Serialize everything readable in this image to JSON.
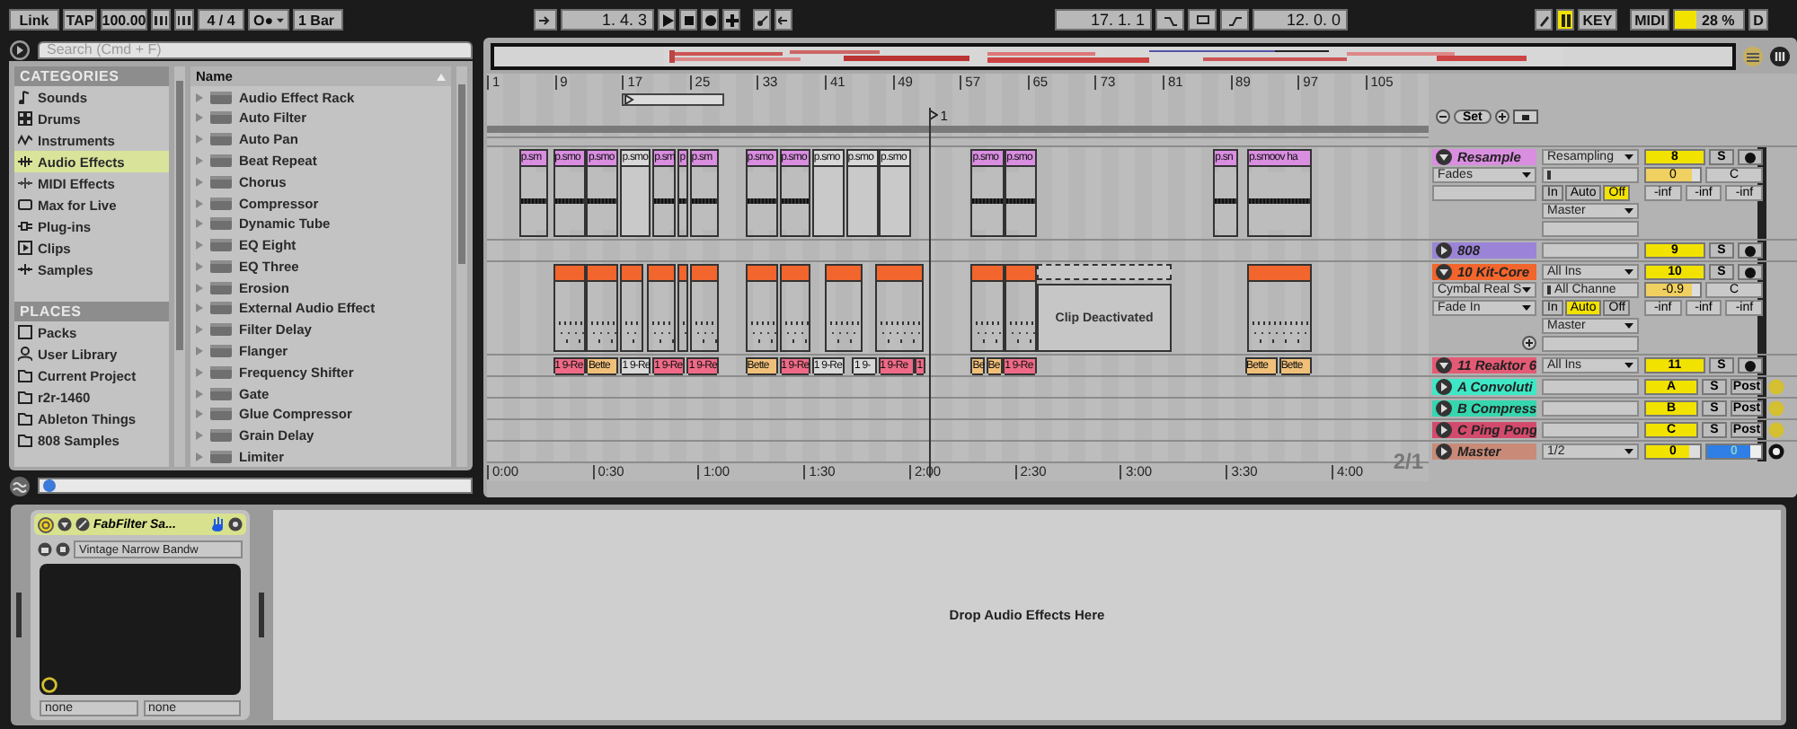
{
  "transport": {
    "link": "Link",
    "tap": "TAP",
    "tempo": "100.00",
    "signature": "4 / 4",
    "metronome": "O●",
    "quantization": "1 Bar",
    "position": "1. 4. 3",
    "loop_start": "17. 1. 1",
    "loop_length": "12. 0. 0",
    "key": "KEY",
    "midi": "MIDI",
    "cpu": "28 %",
    "disk": "D"
  },
  "browser": {
    "search": {
      "placeholder": "Search (Cmd + F)"
    },
    "categories_title": "CATEGORIES",
    "categories": [
      {
        "label": "Sounds",
        "selected": false
      },
      {
        "label": "Drums",
        "selected": false
      },
      {
        "label": "Instruments",
        "selected": false
      },
      {
        "label": "Audio Effects",
        "selected": true
      },
      {
        "label": "MIDI Effects",
        "selected": false
      },
      {
        "label": "Max for Live",
        "selected": false
      },
      {
        "label": "Plug-ins",
        "selected": false
      },
      {
        "label": "Clips",
        "selected": false
      },
      {
        "label": "Samples",
        "selected": false
      }
    ],
    "places_title": "PLACES",
    "places": [
      "Packs",
      "User Library",
      "Current Project",
      "r2r-1460",
      "Ableton Things",
      "808 Samples"
    ],
    "name_header": "Name",
    "items": [
      "Audio Effect Rack",
      "Auto Filter",
      "Auto Pan",
      "Beat Repeat",
      "Chorus",
      "Compressor",
      "Dynamic Tube",
      "EQ Eight",
      "EQ Three",
      "Erosion",
      "External Audio Effect",
      "Filter Delay",
      "Flanger",
      "Frequency Shifter",
      "Gate",
      "Glue Compressor",
      "Grain Delay",
      "Limiter"
    ]
  },
  "arrangement": {
    "bar_numbers": [
      "1",
      "9",
      "17",
      "25",
      "33",
      "41",
      "49",
      "57",
      "65",
      "73",
      "81",
      "89",
      "97",
      "105"
    ],
    "locator": {
      "label": "1"
    },
    "set": "Set",
    "grid": "2/1",
    "time_labels": [
      "0:00",
      "0:30",
      "1:00",
      "1:30",
      "2:00",
      "2:30",
      "3:00",
      "3:30",
      "4:00"
    ],
    "tracks": [
      {
        "name": "Resample",
        "kind": "audio",
        "color": "#d98ee0",
        "expanded": true,
        "number": "8",
        "input": "Resampling",
        "chain": [
          "Fades"
        ],
        "monitor": [
          {
            "label": "In",
            "selected": false
          },
          {
            "label": "Auto",
            "selected": false
          },
          {
            "label": "Off",
            "selected": true
          }
        ],
        "output": "Master",
        "volume": "0",
        "pan": "C",
        "sends": [
          "-inf",
          "-inf",
          "-inf"
        ],
        "solo": "S",
        "clips": [
          {
            "name": "p.sm",
            "active": true
          },
          {
            "name": "p.smo",
            "active": true
          },
          {
            "name": "p.smo",
            "active": true
          },
          {
            "name": "p.smo",
            "active": false
          },
          {
            "name": "p.sm",
            "active": true
          },
          {
            "name": "p",
            "active": true
          },
          {
            "name": "p.sm",
            "active": true
          },
          {
            "name": "p.smo",
            "active": true
          },
          {
            "name": "p.smo",
            "active": true
          },
          {
            "name": "p.smo",
            "active": false
          },
          {
            "name": "p.smo",
            "active": false
          },
          {
            "name": "p.smo",
            "active": false
          },
          {
            "name": "p.smo",
            "active": true
          },
          {
            "name": "p.smo",
            "active": true
          },
          {
            "name": "p.sn",
            "active": true
          },
          {
            "name": "p.smoov ha",
            "active": true
          }
        ]
      },
      {
        "name": "808",
        "kind": "midi",
        "color": "#9b84d8",
        "expanded": false,
        "number": "9",
        "solo": "S"
      },
      {
        "name": "10 Kit-Core",
        "kind": "midi",
        "color": "#f2652c",
        "expanded": true,
        "number": "10",
        "input": "All Ins",
        "input_channel": "All Channe",
        "chain": [
          "Cymbal Real S",
          "Fade In"
        ],
        "monitor": [
          {
            "label": "In",
            "selected": false
          },
          {
            "label": "Auto",
            "selected": true
          },
          {
            "label": "Off",
            "selected": false
          }
        ],
        "output": "Master",
        "volume": "-0.9",
        "pan": "C",
        "sends": [
          "-inf",
          "-inf",
          "-inf"
        ],
        "solo": "S",
        "clips": [
          {
            "active": true
          },
          {
            "active": true
          },
          {
            "active": true
          },
          {
            "active": true
          },
          {
            "active": true
          },
          {
            "active": true
          },
          {
            "active": true
          },
          {
            "active": true
          },
          {
            "active": true
          },
          {
            "active": true
          },
          {
            "active": true
          },
          {
            "active": true
          },
          {
            "active": false,
            "note": "Clip Deactivated"
          },
          {
            "active": true
          }
        ]
      },
      {
        "name": "11 Reaktor 6",
        "kind": "midi",
        "color": "#e35a74",
        "expanded": true,
        "number": "11",
        "input": "All Ins",
        "solo": "S",
        "clips": [
          {
            "name": "1 9-Re",
            "active": true,
            "color": "#ee6a86"
          },
          {
            "name": "Bette",
            "active": true,
            "color": "#f0c07a"
          },
          {
            "name": "1 9-Re",
            "active": false
          },
          {
            "name": "1 9-Re",
            "active": true,
            "color": "#ee6a86"
          },
          {
            "name": "1 9-Re",
            "active": true,
            "color": "#ee6a86"
          },
          {
            "name": "Bette",
            "active": true,
            "color": "#f0c07a"
          },
          {
            "name": "1 9-Re",
            "active": true,
            "color": "#ee6a86"
          },
          {
            "name": "1 9-Re",
            "active": false
          },
          {
            "name": "1 9-",
            "active": false
          },
          {
            "name": "1 9-Re",
            "active": true,
            "color": "#ee6a86"
          },
          {
            "name": "1",
            "active": true,
            "color": "#ee6a86"
          },
          {
            "name": "Be",
            "active": true,
            "color": "#f0c07a"
          },
          {
            "name": "Be",
            "active": true,
            "color": "#f0c07a"
          },
          {
            "name": "1 9-Re",
            "active": true,
            "color": "#ee6a86"
          },
          {
            "name": "Bette",
            "active": true,
            "color": "#f0c07a"
          },
          {
            "name": "Bette",
            "active": true,
            "color": "#f0c07a"
          }
        ]
      },
      {
        "name": "A Convoluti",
        "kind": "return",
        "color": "#3ee8c6",
        "expanded": false,
        "number": "A",
        "solo": "S",
        "post": "Post"
      },
      {
        "name": "B Compress",
        "kind": "return",
        "color": "#36d6ae",
        "expanded": false,
        "number": "B",
        "solo": "S",
        "post": "Post"
      },
      {
        "name": "C Ping Pong",
        "kind": "return",
        "color": "#d24a6c",
        "expanded": false,
        "number": "C",
        "solo": "S",
        "post": "Post"
      },
      {
        "name": "Master",
        "kind": "master",
        "color": "#c98a78",
        "expanded": false,
        "output": "1/2",
        "volume": "0",
        "pan": "0"
      }
    ]
  },
  "device": {
    "name": "FabFilter Sa...",
    "on": true,
    "preset": "Vintage Narrow Bandw",
    "sidechain": [
      "none",
      "none"
    ],
    "drop_hint": "Drop Audio Effects Here"
  }
}
